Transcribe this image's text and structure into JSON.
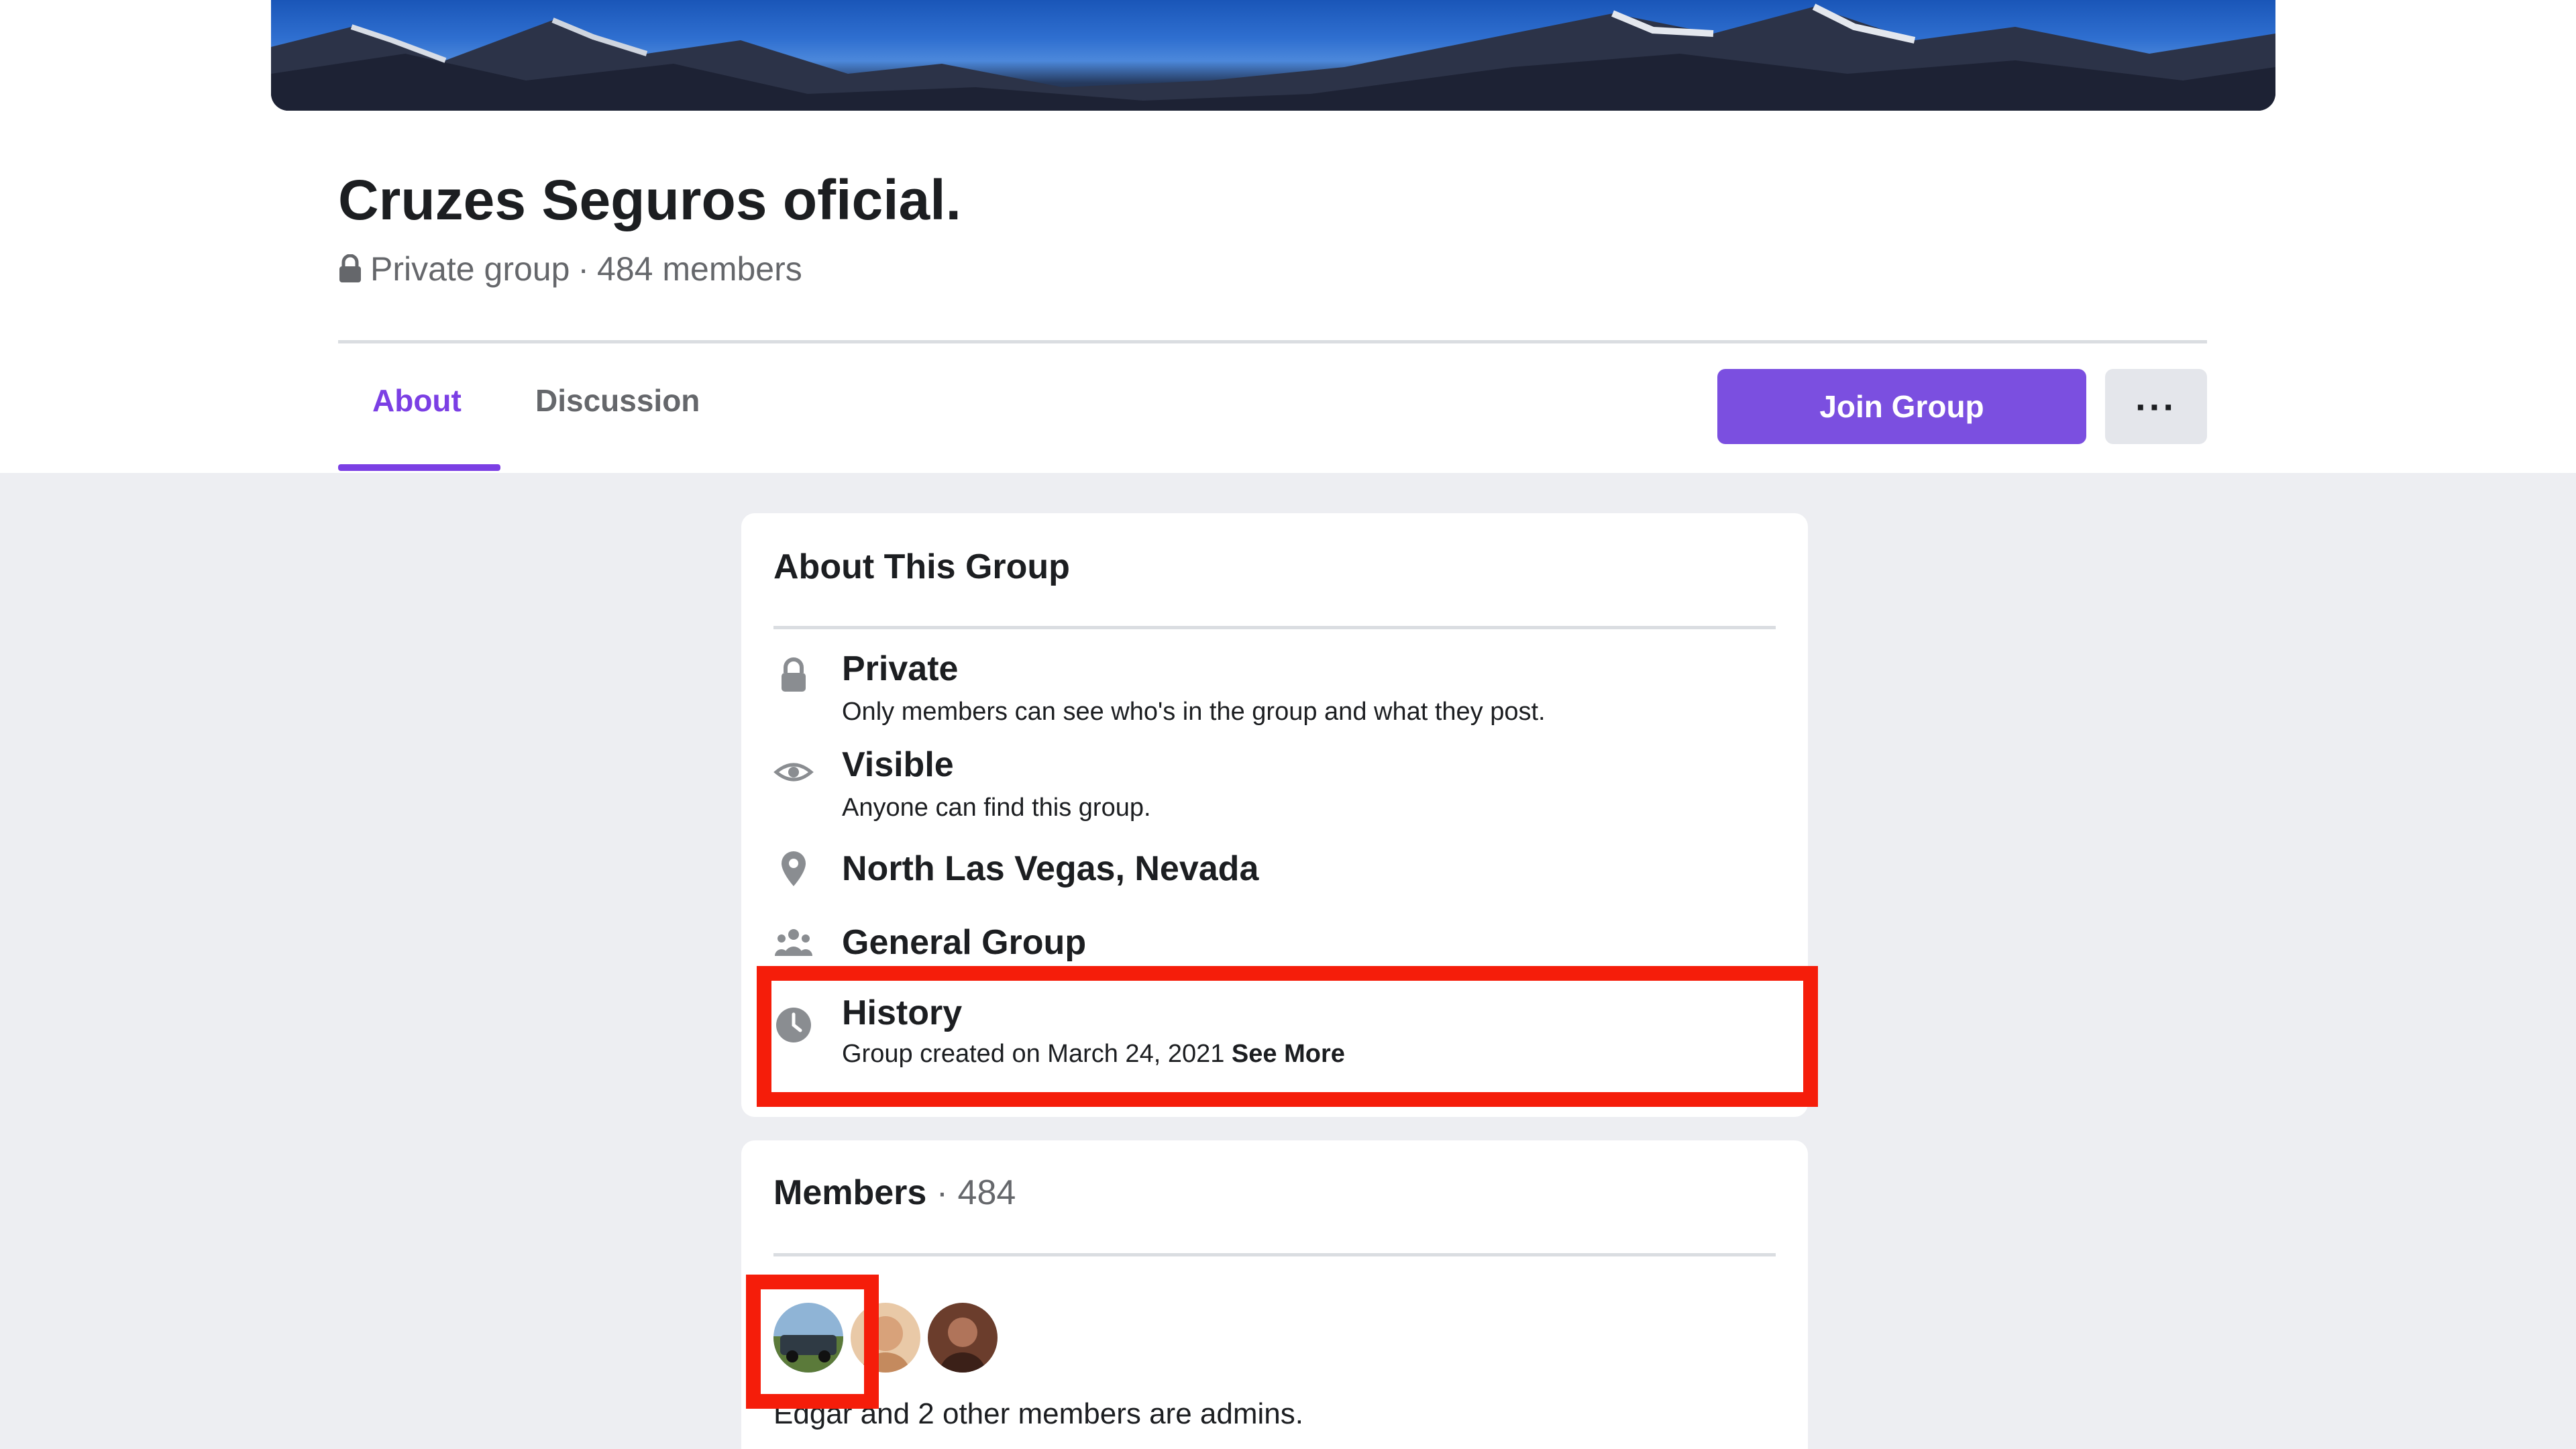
{
  "group": {
    "name": "Cruzes Seguros oficial.",
    "privacy": "Private group",
    "members_label": "484 members",
    "separator": "·"
  },
  "tabs": [
    {
      "label": "About",
      "active": true
    },
    {
      "label": "Discussion",
      "active": false
    }
  ],
  "actions": {
    "join_label": "Join Group",
    "more_label": "···"
  },
  "about": {
    "title": "About This Group",
    "rows": [
      {
        "icon": "lock-icon",
        "title": "Private",
        "desc": "Only members can see who's in the group and what they post."
      },
      {
        "icon": "eye-icon",
        "title": "Visible",
        "desc": "Anyone can find this group."
      },
      {
        "icon": "location-pin-icon",
        "title": "North Las Vegas, Nevada"
      },
      {
        "icon": "people-icon",
        "title": "General Group"
      },
      {
        "icon": "clock-icon",
        "title": "History",
        "desc": "Group created on March 24, 2021",
        "link": "See More"
      }
    ]
  },
  "members": {
    "title": "Members",
    "separator": " · ",
    "count": "484",
    "admins_text": "Edgar and 2 other members are admins."
  },
  "colors": {
    "accent": "#7b3fe4",
    "button": "#7b4fe0",
    "highlight": "#f51d0a",
    "background": "#edeef2"
  }
}
